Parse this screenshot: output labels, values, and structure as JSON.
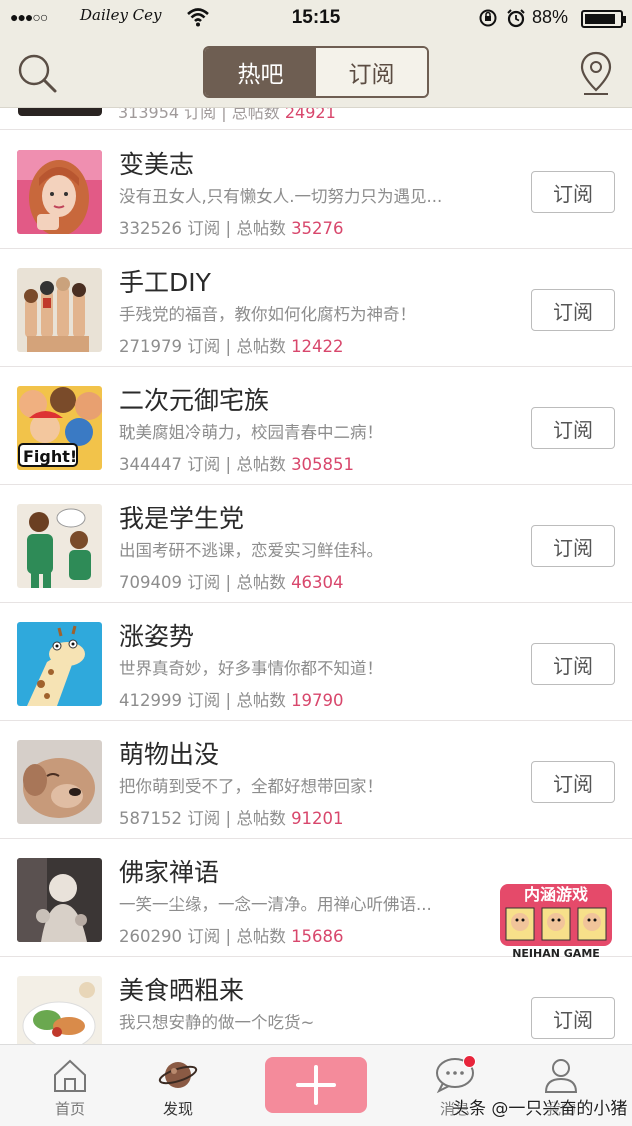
{
  "status_bar": {
    "signal": "●●●○○",
    "carrier": "Dailey Cey",
    "time": "15:15",
    "battery_percent": "88%",
    "battery_level": 0.88
  },
  "nav": {
    "tabs": [
      {
        "label": "热吧",
        "active": true
      },
      {
        "label": "订阅",
        "active": false
      }
    ],
    "left_icon": "search-icon",
    "right_icon": "location-pin-icon"
  },
  "partial_row": {
    "subscribers": "313954",
    "sub_label": "订阅",
    "sep": "|",
    "posts_label": "总帖数",
    "posts": "24921"
  },
  "list": [
    {
      "title": "变美志",
      "desc": "没有丑女人,只有懒女人.一切努力只为遇见...",
      "subscribers": "332526",
      "sub_label": "订阅",
      "sep": "|",
      "posts_label": "总帖数",
      "posts": "35276",
      "button": "订阅"
    },
    {
      "title": "手工DIY",
      "desc": "手残党的福音，教你如何化腐朽为神奇！",
      "subscribers": "271979",
      "sub_label": "订阅",
      "sep": "|",
      "posts_label": "总帖数",
      "posts": "12422",
      "button": "订阅"
    },
    {
      "title": "二次元御宅族",
      "desc": "耽美腐姐冷萌力，校园青春中二病！",
      "subscribers": "344447",
      "sub_label": "订阅",
      "sep": "|",
      "posts_label": "总帖数",
      "posts": "305851",
      "button": "订阅"
    },
    {
      "title": "我是学生党",
      "desc": "出国考研不逃课，恋爱实习鲜佳科。",
      "subscribers": "709409",
      "sub_label": "订阅",
      "sep": "|",
      "posts_label": "总帖数",
      "posts": "46304",
      "button": "订阅"
    },
    {
      "title": "涨姿势",
      "desc": "世界真奇妙，好多事情你都不知道！",
      "subscribers": "412999",
      "sub_label": "订阅",
      "sep": "|",
      "posts_label": "总帖数",
      "posts": "19790",
      "button": "订阅"
    },
    {
      "title": "萌物出没",
      "desc": "把你萌到受不了，全都好想带回家！",
      "subscribers": "587152",
      "sub_label": "订阅",
      "sep": "|",
      "posts_label": "总帖数",
      "posts": "91201",
      "button": "订阅"
    },
    {
      "title": "佛家禅语",
      "desc": "一笑一尘缘，一念一清净。用禅心听佛语...",
      "subscribers": "260290",
      "sub_label": "订阅",
      "sep": "|",
      "posts_label": "总帖数",
      "posts": "15686",
      "button": "订阅"
    },
    {
      "title": "美食晒粗来",
      "desc": "我只想安静的做一个吃货~",
      "subscribers": "",
      "sub_label": "",
      "sep": "",
      "posts_label": "",
      "posts": "",
      "button": "订阅"
    }
  ],
  "game_badge": {
    "title": "内涵游戏",
    "caption": "NEIHAN GAME"
  },
  "tabbar": {
    "home": "首页",
    "discover": "发现",
    "post_icon": "plus-icon",
    "messages": "消息",
    "me": "我的"
  },
  "watermark": "头条 @一只兴奋的小猪",
  "colors": {
    "accent_pink": "#f48b9b",
    "number_red": "#d8476c",
    "segment_brown": "#6e5e52",
    "bar_bg": "#eeece3"
  }
}
